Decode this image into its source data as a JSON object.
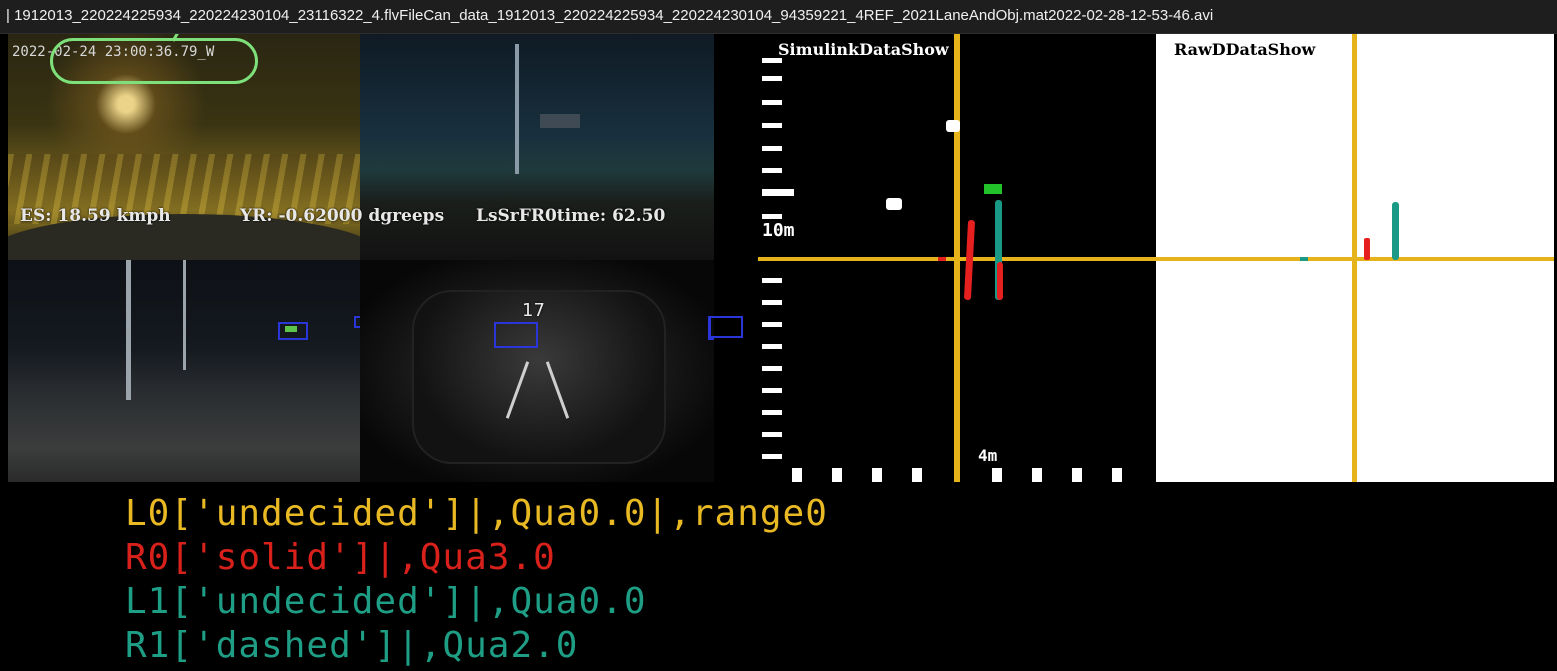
{
  "window": {
    "title": "| 1912013_220224225934_220224230104_23116322_4.flvFileCan_data_1912013_220224225934_220224230104_94359221_4REF_2021LaneAndObj.mat2022-02-28-12-53-46.avi"
  },
  "video": {
    "timestamp": "2022-02-24 23:00:36.79_W",
    "osd": {
      "speed": "ES:  18.59  kmph",
      "yaw_rate": "YR:  -0.62000 dgreeps",
      "lane_time": "LsSrFR0time:  62.50"
    },
    "cluster_speed": "17"
  },
  "plots": {
    "left_title": "SimulinkDataShow",
    "right_title": "RawDDataShow",
    "label_10m": "10m",
    "label_4m": "4m"
  },
  "lane_info": [
    {
      "text": "L0['undecided']|,Qua0.0|,range0",
      "color": "#e8b923"
    },
    {
      "text": "R0['solid']|,Qua3.0",
      "color": "#d9211c"
    },
    {
      "text": "L1['undecided']|,Qua0.0",
      "color": "#1f9e86"
    },
    {
      "text": "R1['dashed']|,Qua2.0",
      "color": "#1f9e86"
    }
  ],
  "colors": {
    "axis_yellow": "#e7b31a",
    "lane_red": "#e61f1f",
    "lane_teal": "#1a9a86",
    "object_green": "#22c22a",
    "annotation_green": "#7de07a"
  }
}
